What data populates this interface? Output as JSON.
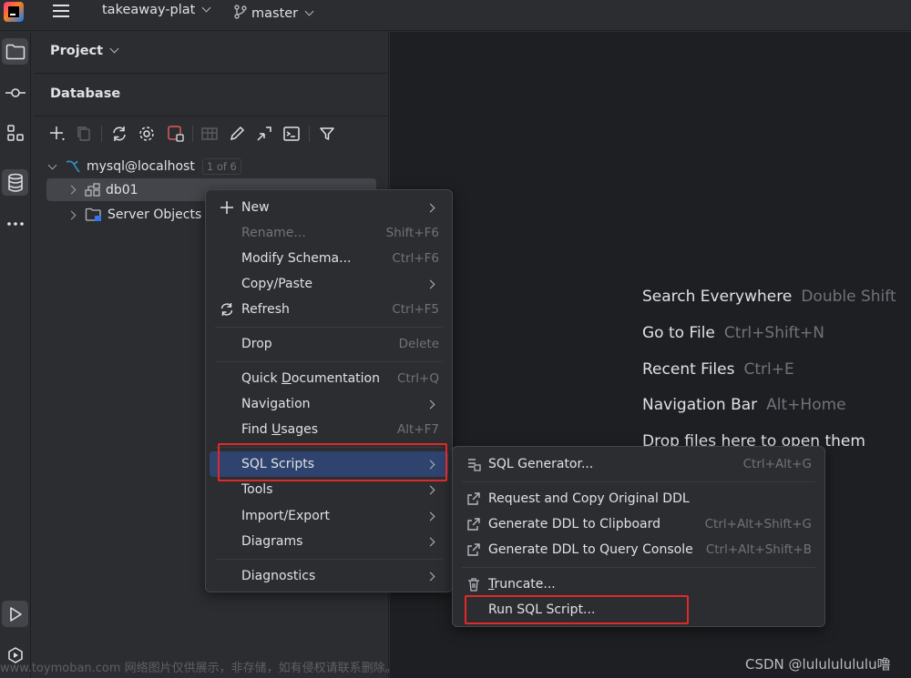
{
  "titlebar": {
    "project_name": "takeaway-plat",
    "branch": "master"
  },
  "panel": {
    "project_label": "Project",
    "database_label": "Database"
  },
  "tree": {
    "datasource": "mysql@localhost",
    "datasource_badge": "1 of 6",
    "schema": "db01",
    "server_objects": "Server Objects"
  },
  "context_menu": {
    "items": [
      {
        "label": "New",
        "shortcut": "",
        "submenu": true
      },
      {
        "label": "Rename...",
        "shortcut": "Shift+F6",
        "disabled": true
      },
      {
        "label": "Modify Schema...",
        "shortcut": "Ctrl+F6"
      },
      {
        "label": "Copy/Paste",
        "shortcut": "",
        "submenu": true
      },
      {
        "label": "Refresh",
        "shortcut": "Ctrl+F5"
      },
      {
        "label": "Drop",
        "shortcut": "Delete"
      },
      {
        "label_pre": "Quick ",
        "label_u": "D",
        "label_post": "ocumentation",
        "shortcut": "Ctrl+Q"
      },
      {
        "label": "Navigation",
        "shortcut": "",
        "submenu": true
      },
      {
        "label_pre": "Find ",
        "label_u": "U",
        "label_post": "sages",
        "shortcut": "Alt+F7"
      },
      {
        "label": "SQL Scripts",
        "shortcut": "",
        "submenu": true,
        "selected": true
      },
      {
        "label": "Tools",
        "shortcut": "",
        "submenu": true
      },
      {
        "label": "Import/Export",
        "shortcut": "",
        "submenu": true
      },
      {
        "label": "Diagrams",
        "shortcut": "",
        "submenu": true
      },
      {
        "label": "Diagnostics",
        "shortcut": "",
        "submenu": true
      }
    ]
  },
  "sql_scripts_submenu": {
    "items": [
      {
        "label": "SQL Generator...",
        "shortcut": "Ctrl+Alt+G"
      },
      {
        "label": "Request and Copy Original DDL",
        "shortcut": ""
      },
      {
        "label": "Generate DDL to Clipboard",
        "shortcut": "Ctrl+Alt+Shift+G"
      },
      {
        "label": "Generate DDL to Query Console",
        "shortcut": "Ctrl+Alt+Shift+B"
      },
      {
        "label_u": "T",
        "label_post": "runcate...",
        "shortcut": ""
      },
      {
        "label": "Run SQL Script...",
        "shortcut": ""
      }
    ]
  },
  "editor_hints": [
    {
      "action": "Search Everywhere",
      "key": "Double Shift"
    },
    {
      "action": "Go to File",
      "key": "Ctrl+Shift+N"
    },
    {
      "action": "Recent Files",
      "key": "Ctrl+E"
    },
    {
      "action": "Navigation Bar",
      "key": "Alt+Home"
    },
    {
      "action": "Drop files here to open them",
      "key": ""
    }
  ],
  "watermark": {
    "left": "www.toymoban.com 网络图片仅供展示，非存储，如有侵权请联系删除。",
    "right": "CSDN @lulululululu噜"
  },
  "colors": {
    "selection": "#2e436e",
    "highlight_box": "#e02a2a",
    "editor_bg": "#1e1f22",
    "panel_bg": "#2b2d30"
  }
}
